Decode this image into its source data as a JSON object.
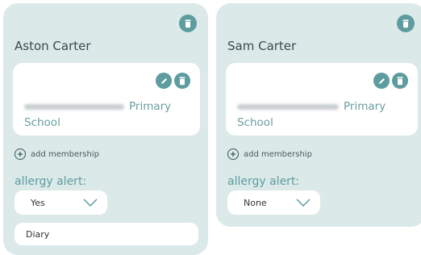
{
  "cards": [
    {
      "name": "Aston Carter",
      "school_suffix": "Primary",
      "school_line2": "School",
      "add_membership": "add membership",
      "allergy_label": "allergy alert:",
      "allergy_value": "Yes",
      "note": "Diary"
    },
    {
      "name": "Sam Carter",
      "school_suffix": "Primary",
      "school_line2": "School",
      "add_membership": "add membership",
      "allergy_label": "allergy alert:",
      "allergy_value": "None"
    }
  ],
  "icons": {
    "delete": "trash-icon",
    "edit": "pencil-icon",
    "add": "plus-circle-icon",
    "dropdown": "chevron-down-icon"
  },
  "colors": {
    "card_bg": "#dbe9e9",
    "accent": "#5e9c9f",
    "panel_bg": "#ffffff"
  }
}
